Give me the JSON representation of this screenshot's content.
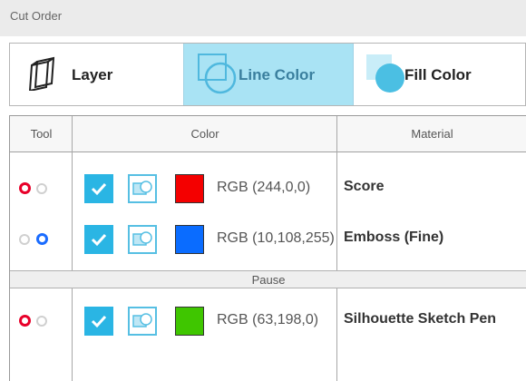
{
  "panel": {
    "title": "Cut Order"
  },
  "modes": [
    {
      "label": "Layer",
      "icon": "layer-icon"
    },
    {
      "label": "Line Color",
      "icon": "line-color-icon",
      "active": true
    },
    {
      "label": "Fill Color",
      "icon": "fill-color-icon"
    }
  ],
  "table": {
    "headers": {
      "tool": "Tool",
      "color": "Color",
      "material": "Material"
    },
    "rows": [
      {
        "tool": "1",
        "checked": true,
        "swatch": "#f40000",
        "rgb": "RGB (244,0,0)",
        "material": "Score"
      },
      {
        "tool": "2",
        "checked": true,
        "swatch": "#0a6cff",
        "rgb": "RGB (10,108,255)",
        "material": "Emboss (Fine)"
      }
    ],
    "pause_label": "Pause",
    "rows_after_pause": [
      {
        "tool": "1",
        "checked": true,
        "swatch": "#3fc600",
        "rgb": "RGB (63,198,0)",
        "material": "Silhouette Sketch Pen"
      }
    ]
  },
  "colors": {
    "accent": "#2ab5e4",
    "active_mode_bg": "#a9e3f4",
    "tool1": "#e8002a",
    "tool2": "#1a6cff"
  }
}
